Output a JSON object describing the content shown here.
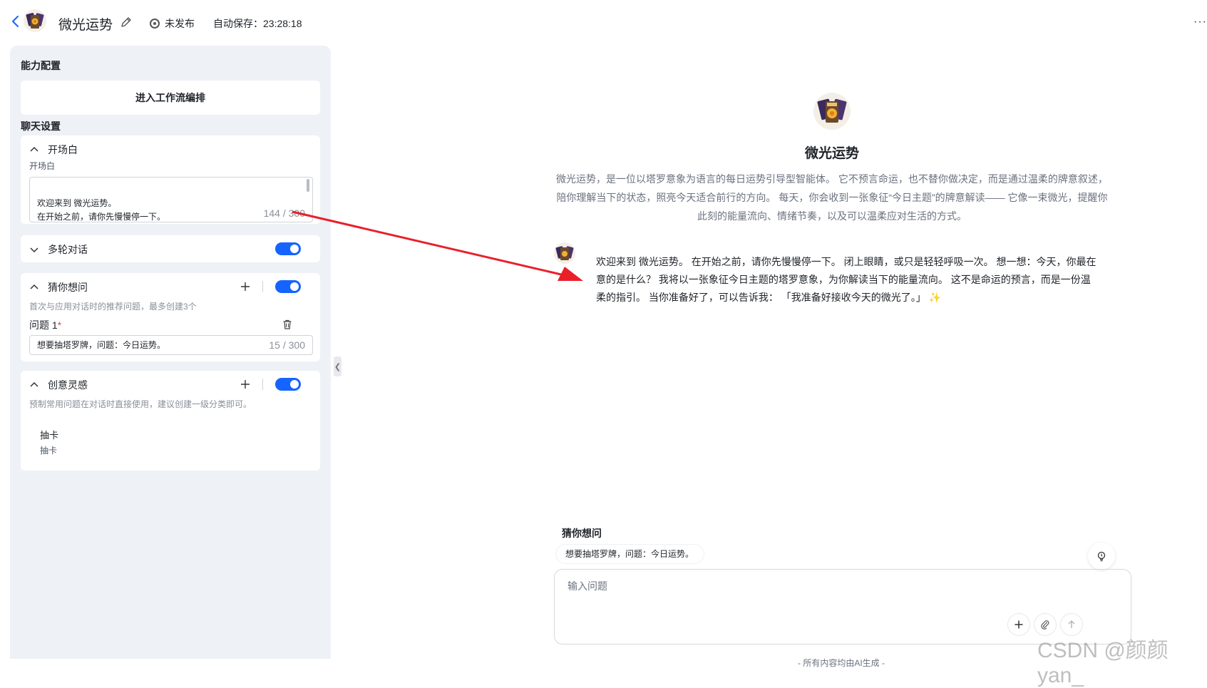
{
  "header": {
    "app_name": "微光运势",
    "status": "未发布",
    "autosave": "自动保存：23:28:18",
    "more": "···"
  },
  "sidebar": {
    "capability_heading": "能力配置",
    "workflow_button": "进入工作流编排",
    "chat_settings_heading": "聊天设置",
    "opening": {
      "title": "开场白",
      "field_label": "开场白",
      "text": "欢迎来到 微光运势。\n在开始之前，请你先慢慢停一下。",
      "counter": "144 / 300"
    },
    "multi_turn": {
      "title": "多轮对话",
      "enabled": true
    },
    "suggested_questions": {
      "title": "猜你想问",
      "hint": "首次与应用对话时的推荐问题，最多创建3个",
      "question_label": "问题 1",
      "required_mark": "*",
      "question_value": "想要抽塔罗牌，问题：今日运势。",
      "counter": "15 / 300",
      "enabled": true
    },
    "creative_inspiration": {
      "title": "创意灵感",
      "hint": "预制常用问题在对话时直接使用，建议创建一级分类即可。",
      "item_title": "抽卡",
      "item_sub": "抽卡",
      "enabled": true
    },
    "collapse_glyph": "❮"
  },
  "preview": {
    "title": "微光运势",
    "description": "微光运势，是一位以塔罗意象为语言的每日运势引导型智能体。 它不预言命运，也不替你做决定，而是通过温柔的牌意叙述，陪你理解当下的状态，照亮今天适合前行的方向。 每天，你会收到一张象征“今日主题”的牌意解读—— 它像一束微光，提醒你此刻的能量流向、情绪节奏，以及可以温柔应对生活的方式。",
    "message": "欢迎来到 微光运势。 在开始之前，请你先慢慢停一下。 闭上眼睛，或只是轻轻呼吸一次。 想一想：今天，你最在意的是什么？ 我将以一张象征今日主题的塔罗意象，为你解读当下的能量流向。 这不是命运的预言，而是一份温柔的指引。 当你准备好了，可以告诉我： 「我准备好接收今天的微光了。」 ✨",
    "suggest_heading": "猜你想问",
    "suggest_chip": "想要抽塔罗牌，问题：今日运势。",
    "input_placeholder": "输入问题",
    "footer": "- 所有内容均由AI生成 -"
  },
  "watermark": "CSDN @颜颜yan_",
  "colors": {
    "accent": "#1664ff",
    "sidebar_bg": "#eef1f6",
    "arrow": "#e8202a"
  }
}
